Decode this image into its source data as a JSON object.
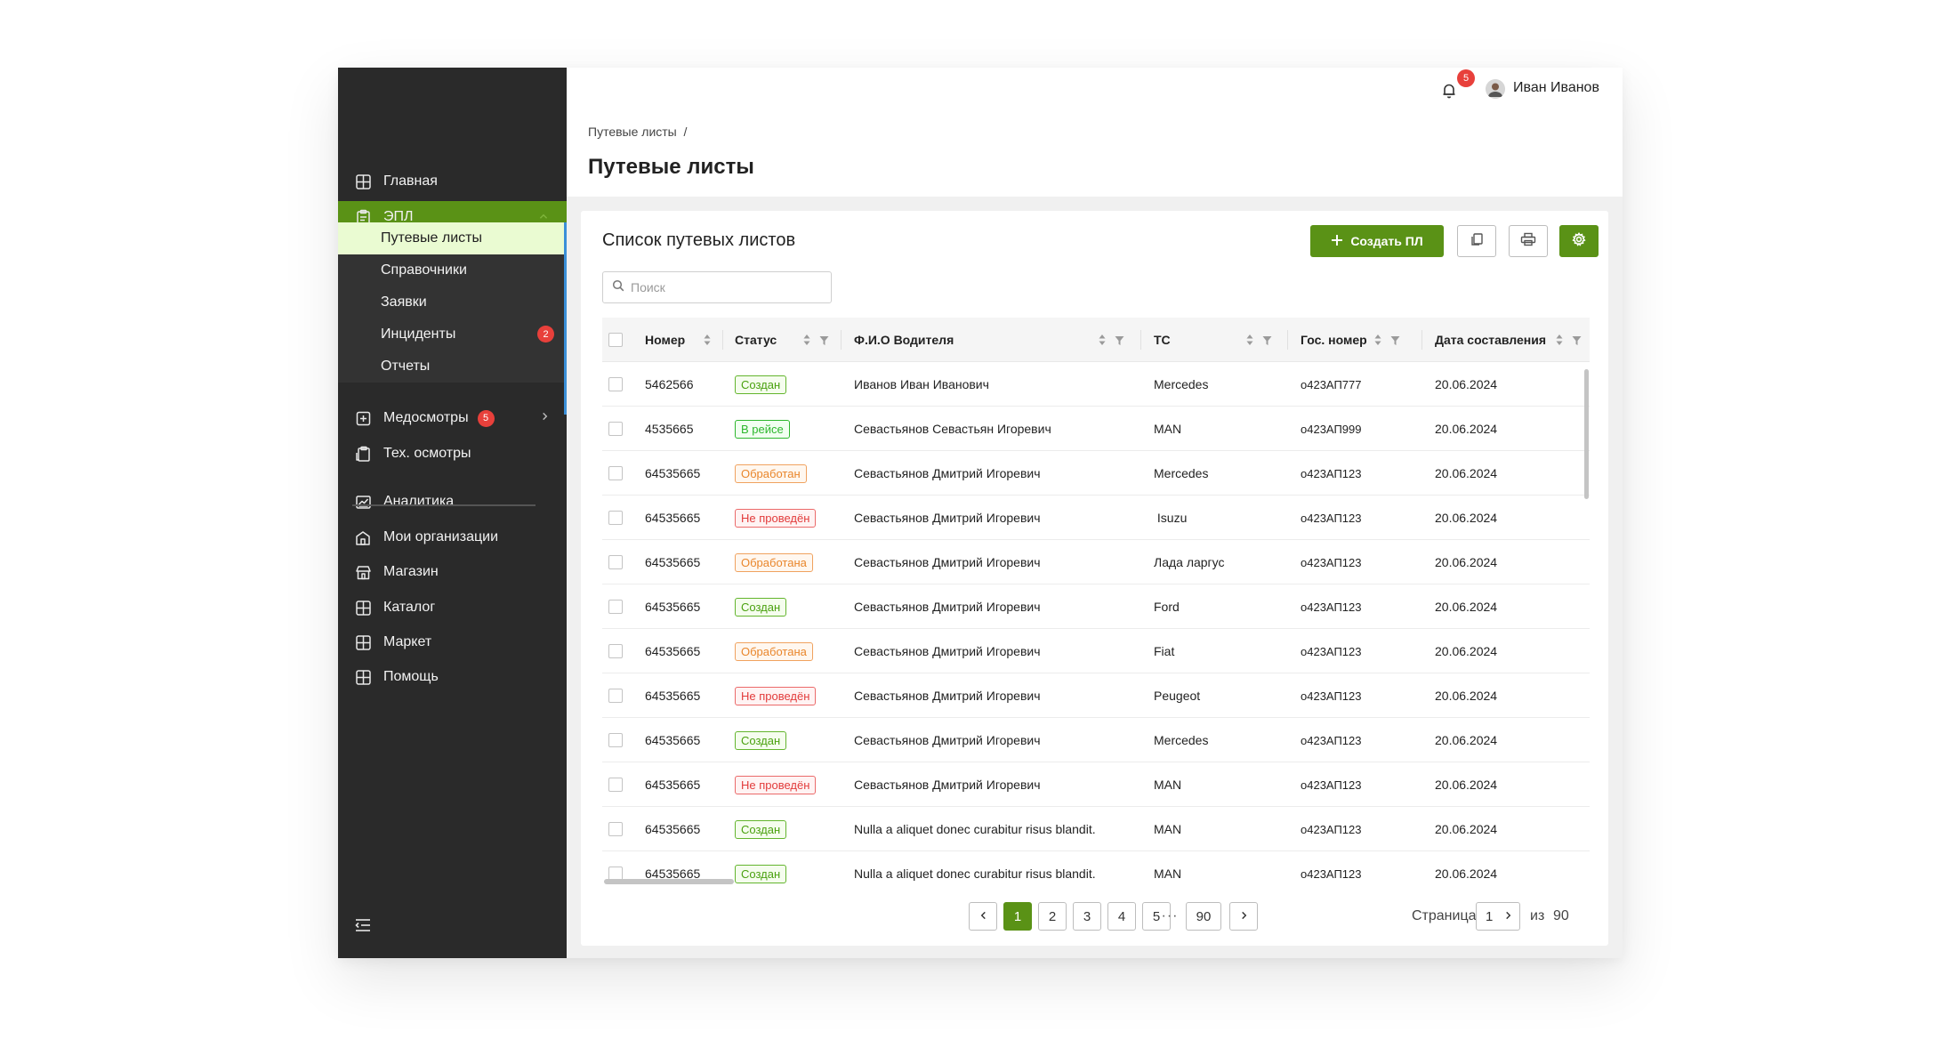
{
  "sidebar": {
    "items": [
      {
        "label": "Главная",
        "icon": "grid-icon"
      },
      {
        "label": "ЭПЛ",
        "icon": "clipboard-icon"
      },
      {
        "label": "Медосмотры",
        "icon": "medical-icon",
        "badge": "5"
      },
      {
        "label": "Тех. осмотры",
        "icon": "tech-inspection-icon"
      },
      {
        "label": "Аналитика",
        "icon": "analytics-icon"
      },
      {
        "label": "Мои организации",
        "icon": "organizations-icon"
      },
      {
        "label": "Магазин",
        "icon": "shop-icon"
      },
      {
        "label": "Каталог",
        "icon": "grid-icon"
      },
      {
        "label": "Маркет",
        "icon": "grid-icon"
      },
      {
        "label": "Помощь",
        "icon": "grid-icon"
      }
    ],
    "sub_items": [
      {
        "label": "Путевые листы"
      },
      {
        "label": "Справочники"
      },
      {
        "label": "Заявки"
      },
      {
        "label": "Инциденты",
        "badge": "2"
      },
      {
        "label": "Отчеты"
      }
    ]
  },
  "header": {
    "notifications": "5",
    "user_name": "Иван Иванов",
    "breadcrumb": "Путевые листы  /",
    "title": "Путевые листы"
  },
  "card": {
    "title": "Список путевых листов",
    "create_label": "Создать ПЛ",
    "search_placeholder": "Поиск"
  },
  "table": {
    "columns": [
      "Номер",
      "Статус",
      "Ф.И.О Водителя",
      "ТС",
      "Гос. номер",
      "Дата составления"
    ],
    "rows": [
      {
        "number": "5462566",
        "status": "Создан",
        "status_kind": "created",
        "driver": "Иванов Иван Иванович",
        "vehicle": "Mercedes",
        "plate": "о423АП777",
        "date": "20.06.2024"
      },
      {
        "number": "4535665",
        "status": "В рейсе",
        "status_kind": "onroute",
        "driver": "Севастьянов Севастьян Игоревич",
        "vehicle": "MAN",
        "plate": "о423АП999",
        "date": "20.06.2024"
      },
      {
        "number": "64535665",
        "status": "Обработан",
        "status_kind": "processed",
        "driver": "Севастьянов Дмитрий Игоревич",
        "vehicle": "Mercedes",
        "plate": "о423АП123",
        "date": "20.06.2024"
      },
      {
        "number": "64535665",
        "status": "Не проведён",
        "status_kind": "notdone",
        "driver": "Севастьянов Дмитрий Игоревич",
        "vehicle": " Isuzu",
        "plate": "о423АП123",
        "date": "20.06.2024"
      },
      {
        "number": "64535665",
        "status": "Обработана",
        "status_kind": "processed",
        "driver": "Севастьянов Дмитрий Игоревич",
        "vehicle": "Лада ларгус",
        "plate": "о423АП123",
        "date": "20.06.2024"
      },
      {
        "number": "64535665",
        "status": "Создан",
        "status_kind": "created",
        "driver": "Севастьянов Дмитрий Игоревич",
        "vehicle": "Ford",
        "plate": "о423АП123",
        "date": "20.06.2024"
      },
      {
        "number": "64535665",
        "status": "Обработана",
        "status_kind": "processed",
        "driver": "Севастьянов Дмитрий Игоревич",
        "vehicle": "Fiat",
        "plate": "о423АП123",
        "date": "20.06.2024"
      },
      {
        "number": "64535665",
        "status": "Не проведён",
        "status_kind": "notdone",
        "driver": "Севастьянов Дмитрий Игоревич",
        "vehicle": "Peugeot",
        "plate": "о423АП123",
        "date": "20.06.2024"
      },
      {
        "number": "64535665",
        "status": "Создан",
        "status_kind": "created",
        "driver": "Севастьянов Дмитрий Игоревич",
        "vehicle": "Mercedes",
        "plate": "о423АП123",
        "date": "20.06.2024"
      },
      {
        "number": "64535665",
        "status": "Не проведён",
        "status_kind": "notdone",
        "driver": "Севастьянов Дмитрий Игоревич",
        "vehicle": "MAN",
        "plate": "о423АП123",
        "date": "20.06.2024"
      },
      {
        "number": "64535665",
        "status": "Создан",
        "status_kind": "created",
        "driver": "Nulla a aliquet donec curabitur risus blandit.",
        "vehicle": "MAN",
        "plate": "о423АП123",
        "date": "20.06.2024"
      },
      {
        "number": "64535665",
        "status": "Создан",
        "status_kind": "created",
        "driver": "Nulla a aliquet donec curabitur risus blandit.",
        "vehicle": "MAN",
        "plate": "о423АП123",
        "date": "20.06.2024"
      }
    ]
  },
  "pagination": {
    "pages": [
      "1",
      "2",
      "3",
      "4",
      "5"
    ],
    "current": "1",
    "ellipsis": "···",
    "last": "90",
    "page_label": "Страница",
    "page_value": "1",
    "of_label": "из",
    "total": "90"
  },
  "colors": {
    "accent": "#5a9216",
    "sidebar_bg": "#2a2a2a",
    "selected_sub_bg": "#eafbd2",
    "badge_red": "#e8403b"
  }
}
